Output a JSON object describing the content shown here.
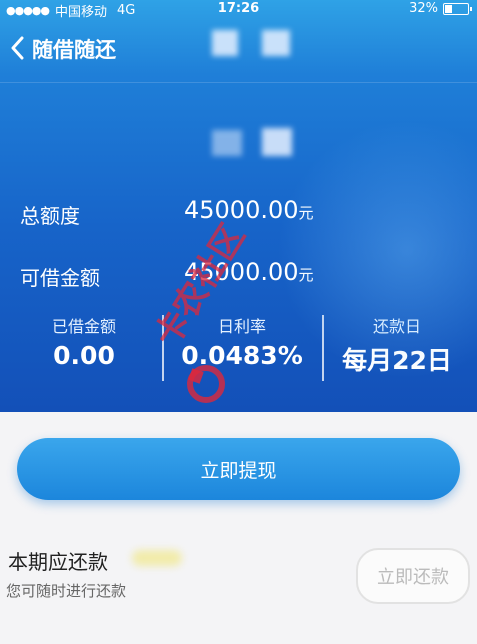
{
  "status_bar": {
    "carrier": "中国移动",
    "network": "4G",
    "time": "17:26",
    "battery": "32%",
    "battery_level": 0.32
  },
  "nav": {
    "title": "随借随还",
    "back_icon": "chevron-left-icon"
  },
  "summary": {
    "total_limit_label": "总额度",
    "total_limit_value": "45000.00",
    "total_limit_unit": "元",
    "available_label": "可借金额",
    "available_value": "45000.00",
    "available_unit": "元"
  },
  "stats": {
    "borrowed_label": "已借金额",
    "borrowed_value": "0.00",
    "rate_label": "日利率",
    "rate_value": "0.0483%",
    "repay_day_label": "还款日",
    "repay_day_value": "每月22日"
  },
  "actions": {
    "withdraw_label": "立即提现"
  },
  "repayment": {
    "title": "本期应还款",
    "subtitle": "您可随时进行还款",
    "repay_label": "立即还款"
  },
  "watermark": {
    "text": "卡农社区"
  },
  "colors": {
    "hero_top": "#2fa2e6",
    "hero_bottom": "#1350b8",
    "button": "#1c86dc",
    "page_bg": "#f4f4f6"
  }
}
